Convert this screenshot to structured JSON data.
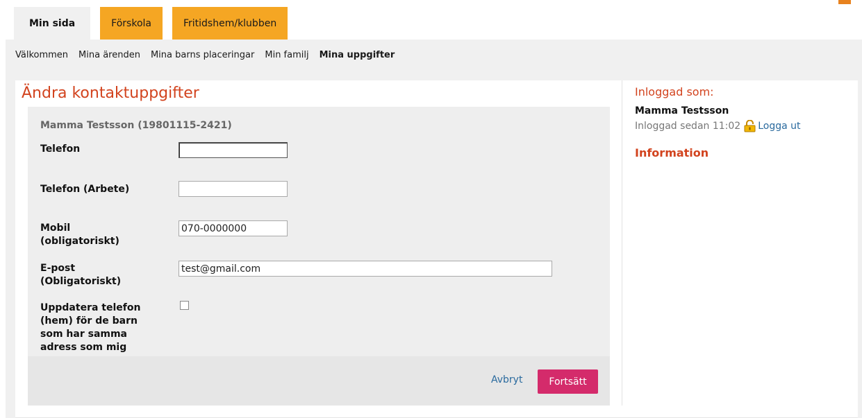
{
  "tabs": [
    {
      "label": "Min sida"
    },
    {
      "label": "Förskola"
    },
    {
      "label": "Fritidshem/klubben"
    }
  ],
  "subnav": [
    {
      "label": "Välkommen"
    },
    {
      "label": "Mina ärenden"
    },
    {
      "label": "Mina barns placeringar"
    },
    {
      "label": "Min familj"
    },
    {
      "label": "Mina uppgifter"
    }
  ],
  "form": {
    "title": "Ändra kontaktuppgifter",
    "person": "Mamma Testsson (19801115-2421)",
    "phone_label": "Telefon",
    "phone_value": "",
    "work_phone_label": "Telefon (Arbete)",
    "work_phone_value": "",
    "mobile_label_1": "Mobil",
    "mobile_label_2": "(obligatoriskt)",
    "mobile_value": "070-0000000",
    "email_label_1": "E-post",
    "email_label_2": "(Obligatoriskt)",
    "email_value": "test@gmail.com",
    "update_label_1": "Uppdatera telefon",
    "update_label_2": "(hem) för de barn",
    "update_label_3": "som har samma",
    "update_label_4": "adress som mig",
    "update_checked": false,
    "cancel_label": "Avbryt",
    "continue_label": "Fortsätt"
  },
  "sidebar": {
    "logged_in_title": "Inloggad som:",
    "user_name": "Mamma Testsson",
    "since_text": "Inloggad sedan 11:02",
    "logout_label": "Logga ut",
    "info_title": "Information",
    "lock_icon": "padlock-icon"
  },
  "colors": {
    "accent_orange": "#f5a623",
    "title_red": "#d2431e",
    "button_pink": "#d42b6b",
    "link_blue": "#2a6a9e"
  }
}
